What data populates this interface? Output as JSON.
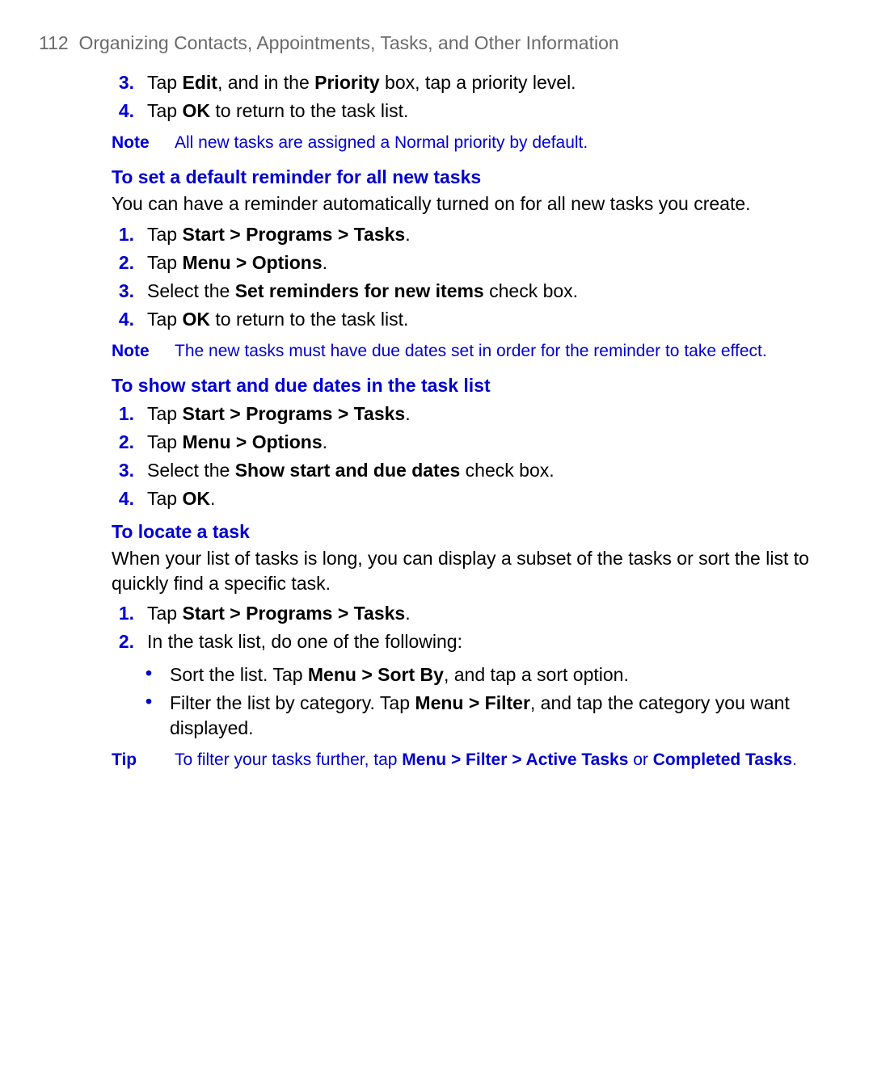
{
  "header": {
    "page_number": "112",
    "title": "Organizing Contacts, Appointments, Tasks, and Other Information"
  },
  "intro_list": [
    {
      "num": "3.",
      "html": "Tap <b>Edit</b>, and in the <b>Priority</b> box, tap a priority level."
    },
    {
      "num": "4.",
      "html": "Tap <b>OK</b> to return to the task list."
    }
  ],
  "note1": {
    "label": "Note",
    "text": "All new tasks are assigned a Normal priority by default."
  },
  "section_reminder": {
    "heading": "To set a default reminder for all new tasks",
    "intro": "You can have a reminder automatically turned on for all new tasks you create.",
    "steps": [
      {
        "num": "1.",
        "html": "Tap <b>Start > Programs > Tasks</b>."
      },
      {
        "num": "2.",
        "html": "Tap <b>Menu > Options</b>."
      },
      {
        "num": "3.",
        "html": "Select the <b>Set reminders for new items</b> check box."
      },
      {
        "num": "4.",
        "html": "Tap <b>OK</b> to return to the task list."
      }
    ]
  },
  "note2": {
    "label": "Note",
    "text": "The new tasks must have due dates set in order for the reminder to take effect."
  },
  "section_dates": {
    "heading": "To show start and due dates in the task list",
    "steps": [
      {
        "num": "1.",
        "html": "Tap <b>Start > Programs > Tasks</b>."
      },
      {
        "num": "2.",
        "html": "Tap <b>Menu > Options</b>."
      },
      {
        "num": "3.",
        "html": "Select the <b>Show start and due dates</b> check box."
      },
      {
        "num": "4.",
        "html": "Tap <b>OK</b>."
      }
    ]
  },
  "section_locate": {
    "heading": "To locate a task",
    "intro": "When your list of tasks is long, you can display a subset of the tasks or sort the list to quickly find a specific task.",
    "steps": [
      {
        "num": "1.",
        "html": "Tap <b>Start > Programs > Tasks</b>."
      },
      {
        "num": "2.",
        "html": "In the task list, do one of the following:"
      }
    ],
    "bullets": [
      {
        "html": "Sort the list. Tap <b>Menu > Sort By</b>, and tap a sort option."
      },
      {
        "html": "Filter the list by category. Tap <b>Menu > Filter</b>, and tap the category you want displayed."
      }
    ]
  },
  "tip": {
    "label": "Tip",
    "html": "To filter your tasks further, tap <b>Menu > Filter > Active Tasks</b> or <b>Completed Tasks</b>."
  }
}
